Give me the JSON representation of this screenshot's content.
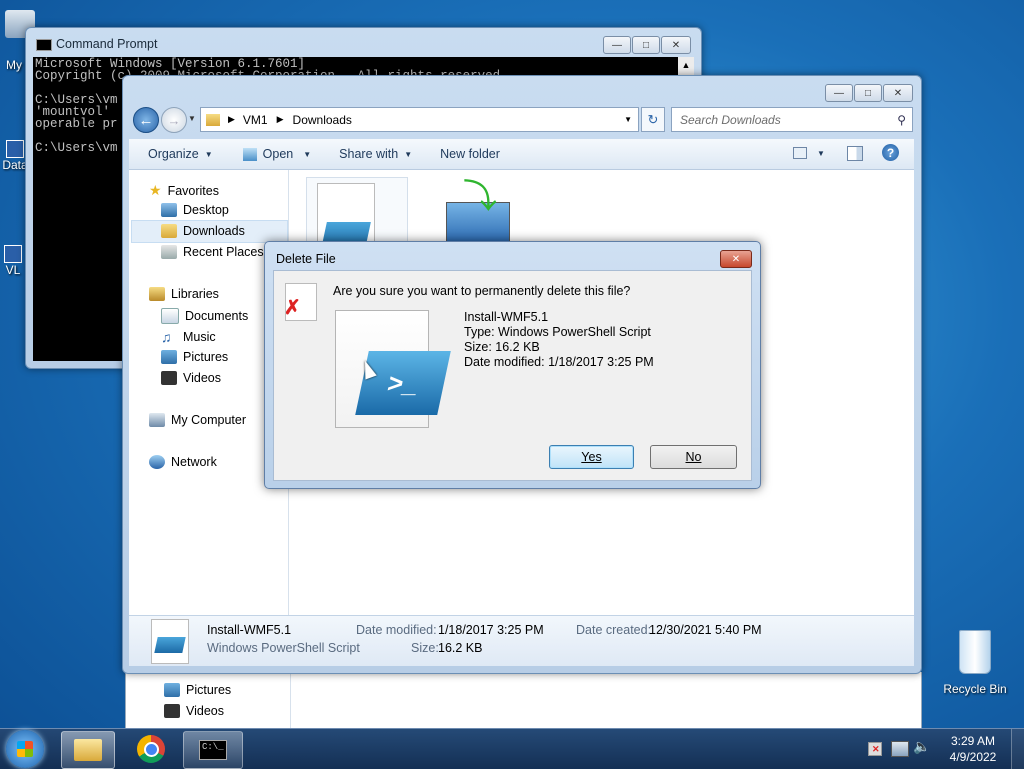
{
  "desktop": {
    "icons": [
      {
        "label": "My C"
      },
      {
        "label": "Data"
      },
      {
        "label": "VL"
      },
      {
        "label": "Recycle Bin"
      }
    ]
  },
  "cmd_window": {
    "title": "Command Prompt",
    "lines": [
      "Microsoft Windows [Version 6.1.7601]",
      "Copyright (c) 2009 Microsoft Corporation.  All rights reserved.",
      "",
      "C:\\Users\\vm",
      "'mountvol'",
      "operable pr",
      "",
      "C:\\Users\\vm"
    ]
  },
  "explorer": {
    "breadcrumb": [
      "VM1",
      "Downloads"
    ],
    "search_placeholder": "Search Downloads",
    "toolbar": {
      "organize": "Organize",
      "open": "Open",
      "share_with": "Share with",
      "new_folder": "New folder"
    },
    "nav": {
      "favorites": "Favorites",
      "desktop": "Desktop",
      "downloads": "Downloads",
      "recent_places": "Recent Places",
      "libraries": "Libraries",
      "documents": "Documents",
      "music": "Music",
      "pictures": "Pictures",
      "videos": "Videos",
      "my_computer": "My Computer",
      "network": "Network"
    },
    "details": {
      "name": "Install-WMF5.1",
      "type": "Windows PowerShell Script",
      "date_modified_label": "Date modified:",
      "date_modified": "1/18/2017 3:25 PM",
      "date_created_label": "Date created:",
      "date_created": "12/30/2021 5:40 PM",
      "size_label": "Size:",
      "size": "16.2 KB"
    },
    "behind_nav": {
      "pictures": "Pictures",
      "videos": "Videos"
    }
  },
  "dialog": {
    "title": "Delete File",
    "question": "Are you sure you want to permanently delete this file?",
    "file_name": "Install-WMF5.1",
    "file_type": "Type: Windows PowerShell Script",
    "file_size": "Size: 16.2 KB",
    "file_modified": "Date modified: 1/18/2017 3:25 PM",
    "yes": "Yes",
    "no": "No"
  },
  "taskbar": {
    "time": "3:29 AM",
    "date": "4/9/2022"
  }
}
